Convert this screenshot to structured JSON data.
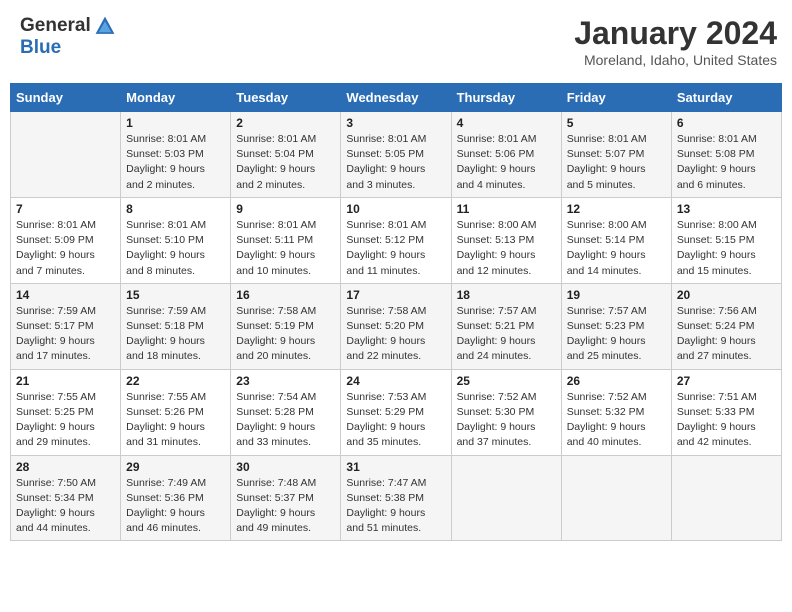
{
  "logo": {
    "line1": "General",
    "line2": "Blue"
  },
  "title": "January 2024",
  "location": "Moreland, Idaho, United States",
  "days_of_week": [
    "Sunday",
    "Monday",
    "Tuesday",
    "Wednesday",
    "Thursday",
    "Friday",
    "Saturday"
  ],
  "weeks": [
    [
      {
        "day": "",
        "info": ""
      },
      {
        "day": "1",
        "info": "Sunrise: 8:01 AM\nSunset: 5:03 PM\nDaylight: 9 hours\nand 2 minutes."
      },
      {
        "day": "2",
        "info": "Sunrise: 8:01 AM\nSunset: 5:04 PM\nDaylight: 9 hours\nand 2 minutes."
      },
      {
        "day": "3",
        "info": "Sunrise: 8:01 AM\nSunset: 5:05 PM\nDaylight: 9 hours\nand 3 minutes."
      },
      {
        "day": "4",
        "info": "Sunrise: 8:01 AM\nSunset: 5:06 PM\nDaylight: 9 hours\nand 4 minutes."
      },
      {
        "day": "5",
        "info": "Sunrise: 8:01 AM\nSunset: 5:07 PM\nDaylight: 9 hours\nand 5 minutes."
      },
      {
        "day": "6",
        "info": "Sunrise: 8:01 AM\nSunset: 5:08 PM\nDaylight: 9 hours\nand 6 minutes."
      }
    ],
    [
      {
        "day": "7",
        "info": "Sunrise: 8:01 AM\nSunset: 5:09 PM\nDaylight: 9 hours\nand 7 minutes."
      },
      {
        "day": "8",
        "info": "Sunrise: 8:01 AM\nSunset: 5:10 PM\nDaylight: 9 hours\nand 8 minutes."
      },
      {
        "day": "9",
        "info": "Sunrise: 8:01 AM\nSunset: 5:11 PM\nDaylight: 9 hours\nand 10 minutes."
      },
      {
        "day": "10",
        "info": "Sunrise: 8:01 AM\nSunset: 5:12 PM\nDaylight: 9 hours\nand 11 minutes."
      },
      {
        "day": "11",
        "info": "Sunrise: 8:00 AM\nSunset: 5:13 PM\nDaylight: 9 hours\nand 12 minutes."
      },
      {
        "day": "12",
        "info": "Sunrise: 8:00 AM\nSunset: 5:14 PM\nDaylight: 9 hours\nand 14 minutes."
      },
      {
        "day": "13",
        "info": "Sunrise: 8:00 AM\nSunset: 5:15 PM\nDaylight: 9 hours\nand 15 minutes."
      }
    ],
    [
      {
        "day": "14",
        "info": "Sunrise: 7:59 AM\nSunset: 5:17 PM\nDaylight: 9 hours\nand 17 minutes."
      },
      {
        "day": "15",
        "info": "Sunrise: 7:59 AM\nSunset: 5:18 PM\nDaylight: 9 hours\nand 18 minutes."
      },
      {
        "day": "16",
        "info": "Sunrise: 7:58 AM\nSunset: 5:19 PM\nDaylight: 9 hours\nand 20 minutes."
      },
      {
        "day": "17",
        "info": "Sunrise: 7:58 AM\nSunset: 5:20 PM\nDaylight: 9 hours\nand 22 minutes."
      },
      {
        "day": "18",
        "info": "Sunrise: 7:57 AM\nSunset: 5:21 PM\nDaylight: 9 hours\nand 24 minutes."
      },
      {
        "day": "19",
        "info": "Sunrise: 7:57 AM\nSunset: 5:23 PM\nDaylight: 9 hours\nand 25 minutes."
      },
      {
        "day": "20",
        "info": "Sunrise: 7:56 AM\nSunset: 5:24 PM\nDaylight: 9 hours\nand 27 minutes."
      }
    ],
    [
      {
        "day": "21",
        "info": "Sunrise: 7:55 AM\nSunset: 5:25 PM\nDaylight: 9 hours\nand 29 minutes."
      },
      {
        "day": "22",
        "info": "Sunrise: 7:55 AM\nSunset: 5:26 PM\nDaylight: 9 hours\nand 31 minutes."
      },
      {
        "day": "23",
        "info": "Sunrise: 7:54 AM\nSunset: 5:28 PM\nDaylight: 9 hours\nand 33 minutes."
      },
      {
        "day": "24",
        "info": "Sunrise: 7:53 AM\nSunset: 5:29 PM\nDaylight: 9 hours\nand 35 minutes."
      },
      {
        "day": "25",
        "info": "Sunrise: 7:52 AM\nSunset: 5:30 PM\nDaylight: 9 hours\nand 37 minutes."
      },
      {
        "day": "26",
        "info": "Sunrise: 7:52 AM\nSunset: 5:32 PM\nDaylight: 9 hours\nand 40 minutes."
      },
      {
        "day": "27",
        "info": "Sunrise: 7:51 AM\nSunset: 5:33 PM\nDaylight: 9 hours\nand 42 minutes."
      }
    ],
    [
      {
        "day": "28",
        "info": "Sunrise: 7:50 AM\nSunset: 5:34 PM\nDaylight: 9 hours\nand 44 minutes."
      },
      {
        "day": "29",
        "info": "Sunrise: 7:49 AM\nSunset: 5:36 PM\nDaylight: 9 hours\nand 46 minutes."
      },
      {
        "day": "30",
        "info": "Sunrise: 7:48 AM\nSunset: 5:37 PM\nDaylight: 9 hours\nand 49 minutes."
      },
      {
        "day": "31",
        "info": "Sunrise: 7:47 AM\nSunset: 5:38 PM\nDaylight: 9 hours\nand 51 minutes."
      },
      {
        "day": "",
        "info": ""
      },
      {
        "day": "",
        "info": ""
      },
      {
        "day": "",
        "info": ""
      }
    ]
  ]
}
